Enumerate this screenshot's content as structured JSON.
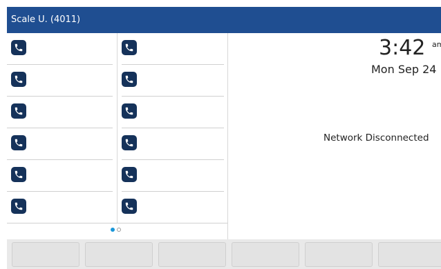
{
  "header": {
    "title": "Scale U. (4011)"
  },
  "line_keys": {
    "columns": [
      {
        "keys": [
          {
            "icon": "phone-icon",
            "label": ""
          },
          {
            "icon": "phone-icon",
            "label": ""
          },
          {
            "icon": "phone-icon",
            "label": ""
          },
          {
            "icon": "phone-icon",
            "label": ""
          },
          {
            "icon": "phone-icon",
            "label": ""
          },
          {
            "icon": "phone-icon",
            "label": ""
          }
        ]
      },
      {
        "keys": [
          {
            "icon": "phone-icon",
            "label": ""
          },
          {
            "icon": "phone-icon",
            "label": ""
          },
          {
            "icon": "phone-icon",
            "label": ""
          },
          {
            "icon": "phone-icon",
            "label": ""
          },
          {
            "icon": "phone-icon",
            "label": ""
          },
          {
            "icon": "phone-icon",
            "label": ""
          }
        ]
      }
    ],
    "pages": {
      "current": 1,
      "total": 2
    }
  },
  "clock": {
    "time": "3:42",
    "ampm": "am",
    "date": "Mon Sep 24"
  },
  "status": {
    "text": "Network Disconnected"
  },
  "softkeys": [
    {
      "label": ""
    },
    {
      "label": ""
    },
    {
      "label": ""
    },
    {
      "label": ""
    },
    {
      "label": ""
    },
    {
      "label": ""
    }
  ],
  "colors": {
    "header_bg": "#1f4e91",
    "icon_bg": "#15325a",
    "page_dot_active": "#1a97d9"
  }
}
